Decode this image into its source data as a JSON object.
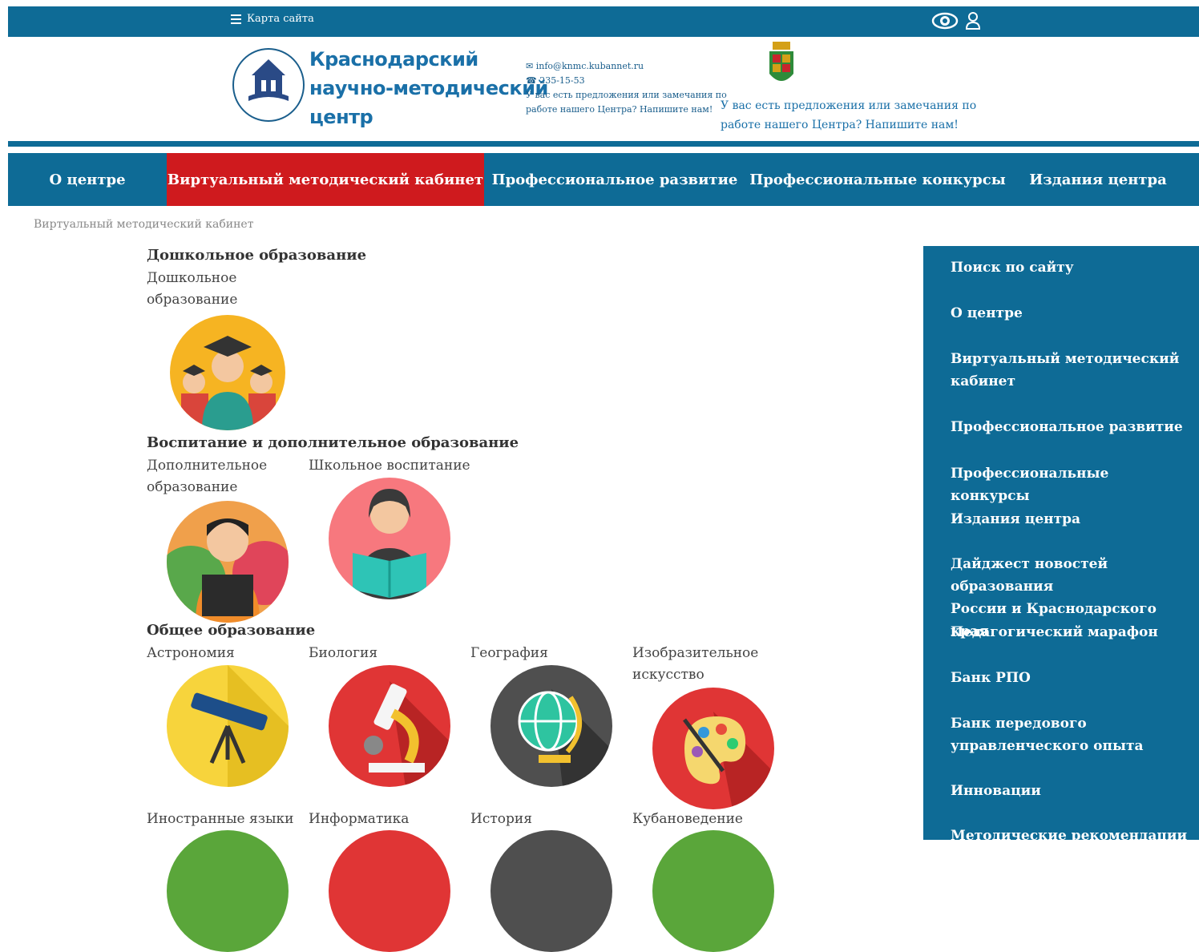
{
  "topbar": {
    "sitemap_label": "Карта сайта",
    "icons": [
      "menu-icon",
      "eye-icon",
      "user-icon"
    ]
  },
  "header": {
    "logo_line1": "Краснодарский",
    "logo_line2": "научно-методический",
    "logo_line3": "центр",
    "email": "info@knmc.kubannet.ru",
    "phone": "235-15-53",
    "small_note_line1": "У вас есть предложения или замечания по",
    "small_note_line2": "работе нашего Центра? Напишите нам!",
    "suggest_line1": "У вас есть предложения или замечания по",
    "suggest_line2": "работе нашего Центра? Напишите нам!"
  },
  "nav": {
    "items": [
      "О центре",
      "Виртуальный методический кабинет",
      "Профессиональное развитие",
      "Профессиональные конкурсы",
      "Издания центра"
    ]
  },
  "breadcrumb": "Виртуальный методический кабинет",
  "sections": {
    "preschool": {
      "title": "Дошкольное образование",
      "tiles": [
        {
          "line1": "Дошкольное",
          "line2": "образование"
        }
      ]
    },
    "upbringing": {
      "title": "Воспитание и дополнительное образование",
      "tiles": [
        {
          "line1": "Дополнительное",
          "line2": "образование"
        },
        {
          "line1": "Школьное воспитание",
          "line2": ""
        }
      ]
    },
    "general": {
      "title": "Общее образование",
      "tiles": [
        {
          "line1": "Астрономия",
          "line2": ""
        },
        {
          "line1": "Биология",
          "line2": ""
        },
        {
          "line1": "География",
          "line2": ""
        },
        {
          "line1": "Изобразительное",
          "line2": "искусство"
        },
        {
          "line1": "Иностранные языки",
          "line2": ""
        },
        {
          "line1": "Информатика",
          "line2": ""
        },
        {
          "line1": "История",
          "line2": ""
        },
        {
          "line1": "Кубановедение",
          "line2": ""
        }
      ]
    }
  },
  "sidebar": {
    "links": [
      {
        "line1": "Поиск по сайту",
        "line2": ""
      },
      {
        "line1": "О центре",
        "line2": ""
      },
      {
        "line1": "Виртуальный методический",
        "line2": "кабинет"
      },
      {
        "line1": "Профессиональное развитие",
        "line2": ""
      },
      {
        "line1": "Профессиональные конкурсы",
        "line2": ""
      },
      {
        "line1": "Издания центра",
        "line2": ""
      },
      {
        "line1": "Дайджест новостей образования",
        "line2": "России и Краснодарского края"
      },
      {
        "line1": "Педагогический марафон",
        "line2": ""
      },
      {
        "line1": "Банк РПО",
        "line2": ""
      },
      {
        "line1": "Банк передового",
        "line2": "управленческого опыта"
      },
      {
        "line1": "Инновации",
        "line2": ""
      },
      {
        "line1": "Методические рекомендации",
        "line2": ""
      }
    ]
  },
  "colors": {
    "brand_blue": "#0e6b96",
    "active_red": "#cf1a1e"
  }
}
